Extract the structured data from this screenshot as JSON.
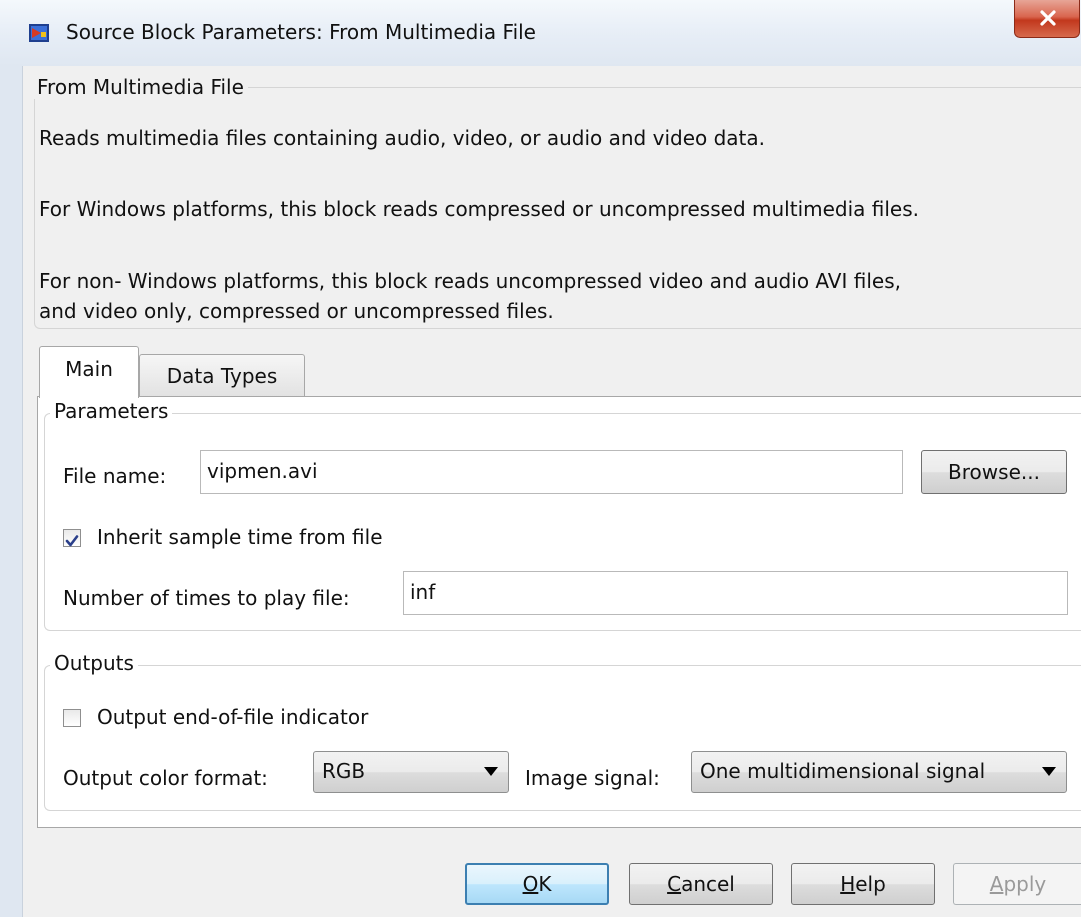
{
  "window": {
    "title": "Source Block Parameters: From Multimedia File",
    "close_glyph": "X"
  },
  "description": {
    "group_title": "From Multimedia File",
    "line1": "Reads multimedia files containing audio, video, or audio and video data.",
    "line2": "For Windows platforms, this block reads compressed or uncompressed multimedia files.",
    "line3a": "For non- Windows platforms, this block reads uncompressed video and audio AVI files,",
    "line3b": "and video only, compressed or uncompressed files."
  },
  "tabs": [
    {
      "label": "Main",
      "selected": true
    },
    {
      "label": "Data Types",
      "selected": false
    }
  ],
  "parameters": {
    "group_title": "Parameters",
    "file_name_label": "File name:",
    "file_name_value": "vipmen.avi",
    "browse_label": "Browse...",
    "inherit_label": "Inherit sample time from file",
    "inherit_checked": true,
    "play_times_label": "Number of times to play file:",
    "play_times_value": "inf"
  },
  "outputs": {
    "group_title": "Outputs",
    "eof_label": "Output end-of-file indicator",
    "eof_checked": false,
    "color_format_label": "Output color format:",
    "color_format_value": "RGB",
    "image_signal_label": "Image signal:",
    "image_signal_value": "One multidimensional signal"
  },
  "buttons": {
    "ok": {
      "mnemonic": "O",
      "rest": "K"
    },
    "cancel": {
      "mnemonic": "C",
      "rest": "ancel"
    },
    "help": {
      "mnemonic": "H",
      "rest": "elp"
    },
    "apply": {
      "mnemonic": "A",
      "rest": "pply"
    }
  },
  "colors": {
    "title_bar": "#dfe7f1",
    "close_button": "#c2381d",
    "default_button_border": "#3c7fb1",
    "dialog_background": "#f0f0f0"
  },
  "icons": [
    "simulink-block-icon",
    "close-icon",
    "checkmark-icon",
    "chevron-down-icon"
  ]
}
